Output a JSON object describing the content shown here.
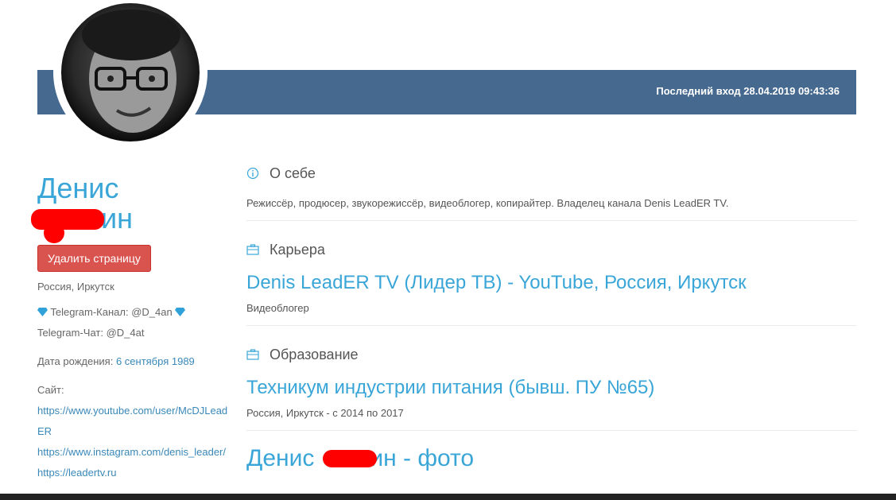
{
  "header": {
    "last_login": "Последний вход 28.04.2019 09:43:36"
  },
  "profile": {
    "first_name": "Денис",
    "last_name_visible": "ин",
    "delete_button": "Удалить страницу",
    "location": "Россия, Иркутск",
    "telegram_channel": "Telegram-Канал: @D_4an",
    "telegram_chat": "Telegram-Чат: @D_4at",
    "birth_label": "Дата рождения: ",
    "birth_value": "6 сентября 1989",
    "site_label": "Сайт:",
    "site_links": [
      "https://www.youtube.com/user/McDJLeadER",
      "https://www.instagram.com/denis_leader/",
      "https://leadertv.ru"
    ]
  },
  "sections": {
    "about": {
      "title": "О себе",
      "text": "Режиссёр, продюсер, звукорежиссёр, видеоблогер, копирайтер. Владелец канала Denis LeadER TV."
    },
    "career": {
      "title": "Карьера",
      "link": "Denis LeadER TV (Лидер ТВ) - YouTube, Россия, Иркутск",
      "text": "Видеоблогер"
    },
    "education": {
      "title": "Образование",
      "link": "Техникум индустрии питания (бывш. ПУ №65)",
      "text": "Россия, Иркутск - с 2014 по 2017"
    },
    "photos": {
      "title_start": "Денис",
      "title_end": "ин - фото"
    }
  },
  "colors": {
    "banner": "#46698f",
    "accent": "#3aa6d8",
    "danger": "#d9534f",
    "redaction": "#ff0000"
  },
  "icons": {
    "about": "info-icon",
    "career": "briefcase-icon",
    "education": "briefcase-icon",
    "telegram": "diamond-icon"
  }
}
